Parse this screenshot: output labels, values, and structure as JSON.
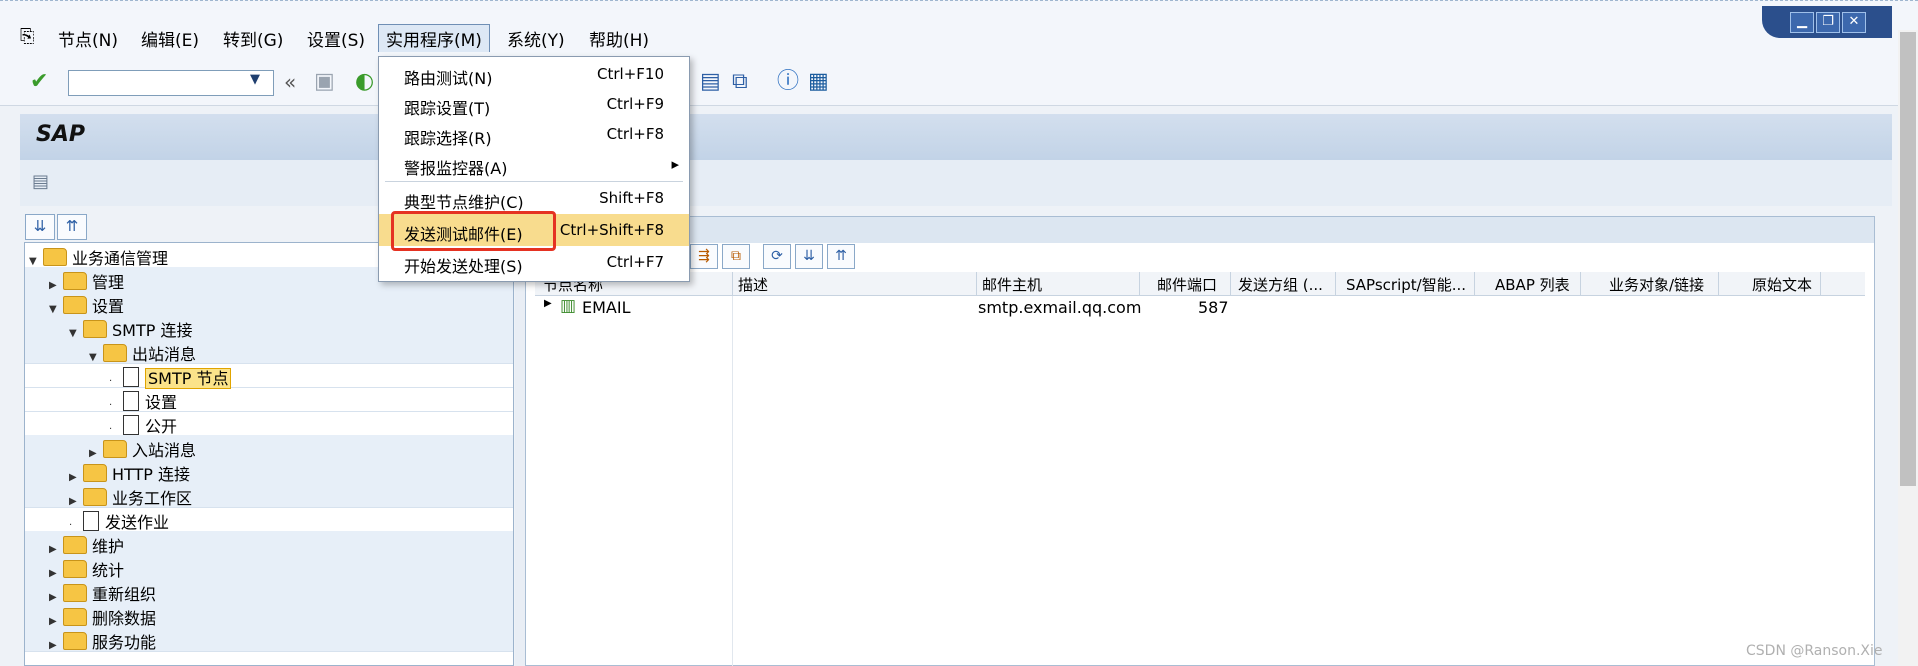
{
  "menubar": {
    "items": [
      "节点(N)",
      "编辑(E)",
      "转到(G)",
      "设置(S)",
      "实用程序(M)",
      "系统(Y)",
      "帮助(H)"
    ]
  },
  "window_controls": {
    "min": "▁",
    "restore": "❐",
    "close": "✕"
  },
  "toolbar": {
    "command_placeholder": ""
  },
  "app": {
    "title": "SAP"
  },
  "tree": {
    "items": [
      "业务通信管理",
      "管理",
      "设置",
      "SMTP 连接",
      "出站消息",
      "SMTP 节点",
      "设置",
      "公开",
      "入站消息",
      "HTTP 连接",
      "业务工作区",
      "发送作业",
      "维护",
      "统计",
      "重新组织",
      "删除数据",
      "服务功能"
    ]
  },
  "grid": {
    "columns": [
      "节点名称",
      "描述",
      "邮件主机",
      "邮件端口",
      "发送方组 (...",
      "SAPscript/智能...",
      "ABAP 列表",
      "业务对象/链接",
      "原始文本"
    ],
    "rows": [
      {
        "node": "EMAIL",
        "description": "",
        "host": "smtp.exmail.qq.com",
        "port": "587"
      }
    ]
  },
  "dropdown": {
    "items": [
      {
        "label": "路由测试(N)",
        "shortcut": "Ctrl+F10"
      },
      {
        "label": "跟踪设置(T)",
        "shortcut": "Ctrl+F9"
      },
      {
        "label": "跟踪选择(R)",
        "shortcut": "Ctrl+F8"
      },
      {
        "label": "警报监控器(A)",
        "shortcut": "▸"
      },
      {
        "label": "典型节点维护(C)",
        "shortcut": "Shift+F8"
      },
      {
        "label": "发送测试邮件(E)",
        "shortcut": "Ctrl+Shift+F8"
      },
      {
        "label": "开始发送处理(S)",
        "shortcut": "Ctrl+F7"
      }
    ]
  },
  "footer": {
    "brand": "CSDN @Ranson.Xie"
  },
  "colors": {
    "highlight": "#f8dc8e",
    "annotation_box": "#e53222"
  }
}
